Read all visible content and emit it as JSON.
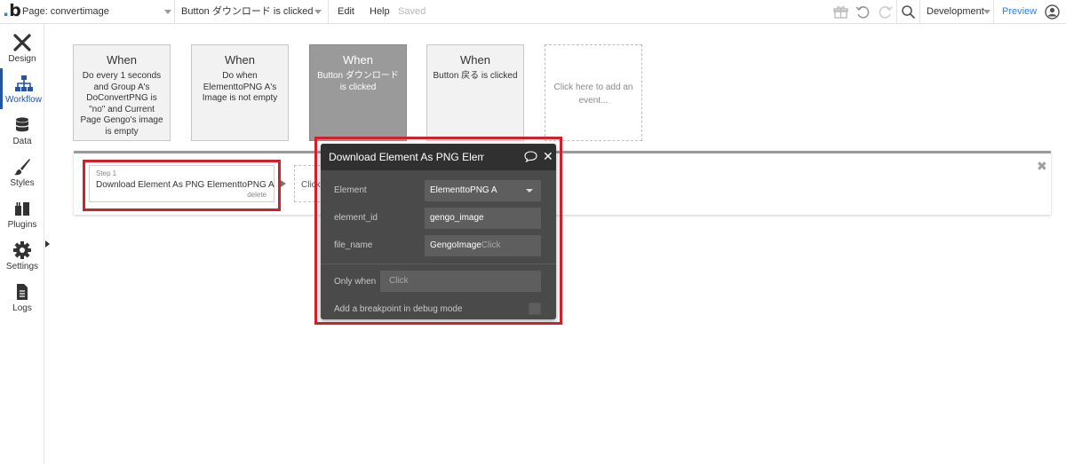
{
  "topbar": {
    "page_label": "Page: convertimage",
    "event_label": "Button ダウンロード is clicked",
    "menu_edit": "Edit",
    "menu_help": "Help",
    "saved": "Saved",
    "env": "Development",
    "preview": "Preview"
  },
  "rail": {
    "items": [
      {
        "label": "Design",
        "icon": "design-icon"
      },
      {
        "label": "Workflow",
        "icon": "workflow-icon"
      },
      {
        "label": "Data",
        "icon": "database-icon"
      },
      {
        "label": "Styles",
        "icon": "brush-icon"
      },
      {
        "label": "Plugins",
        "icon": "plug-icon"
      },
      {
        "label": "Settings",
        "icon": "gear-icon"
      },
      {
        "label": "Logs",
        "icon": "document-icon"
      }
    ]
  },
  "events": [
    {
      "when": "When",
      "desc": "Do every 1 seconds and Group A's DoConvertPNG is \"no\" and Current Page Gengo's image is empty"
    },
    {
      "when": "When",
      "desc": "Do when ElementtoPNG A's Image is not empty"
    },
    {
      "when": "When",
      "desc": "Button ダウンロード is clicked"
    },
    {
      "when": "When",
      "desc": "Button 戻る is clicked"
    },
    {
      "desc": "Click here to add an event..."
    }
  ],
  "step": {
    "label": "Step 1",
    "title": "Download Element As PNG ElementtoPNG A",
    "delete": "delete",
    "next": "Click"
  },
  "editor": {
    "title": "Download Element As PNG Eleme",
    "fields": [
      {
        "label": "Element",
        "value": "ElementtoPNG A"
      },
      {
        "label": "element_id",
        "value": "gengo_image"
      },
      {
        "label": "file_name",
        "value": "GengoImage",
        "placeholder": "Click"
      }
    ],
    "only_when_label": "Only when",
    "only_when_placeholder": "Click",
    "breakpoint_label": "Add a breakpoint in debug mode"
  },
  "colors": {
    "accent": "#2f80ed",
    "rail_active": "#2354a8",
    "highlight_red": "#d0202b",
    "editor_bg": "#4a4a4a"
  }
}
